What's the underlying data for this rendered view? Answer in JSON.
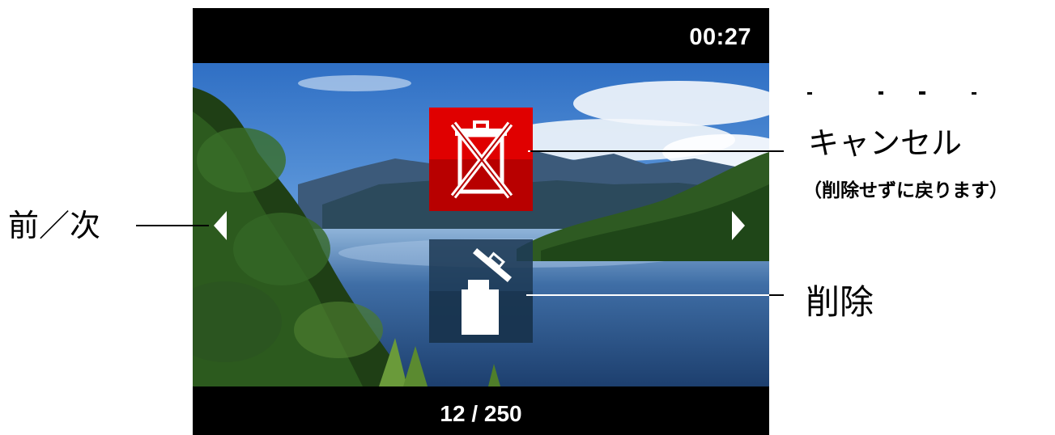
{
  "screen": {
    "timer": "00:27",
    "counter": "12 / 250"
  },
  "buttons": {
    "cancel": {
      "icon": "trash-crossed-icon",
      "color": "#e00000"
    },
    "delete": {
      "icon": "trash-open-icon",
      "color": "#1e3a55"
    }
  },
  "callouts": {
    "prev_next": "前／次",
    "cancel": "キャンセル",
    "cancel_sub": "（削除せずに戻ります）",
    "delete": "削除"
  },
  "icons": {
    "prev": "triangle-left-icon",
    "next": "triangle-right-icon"
  }
}
